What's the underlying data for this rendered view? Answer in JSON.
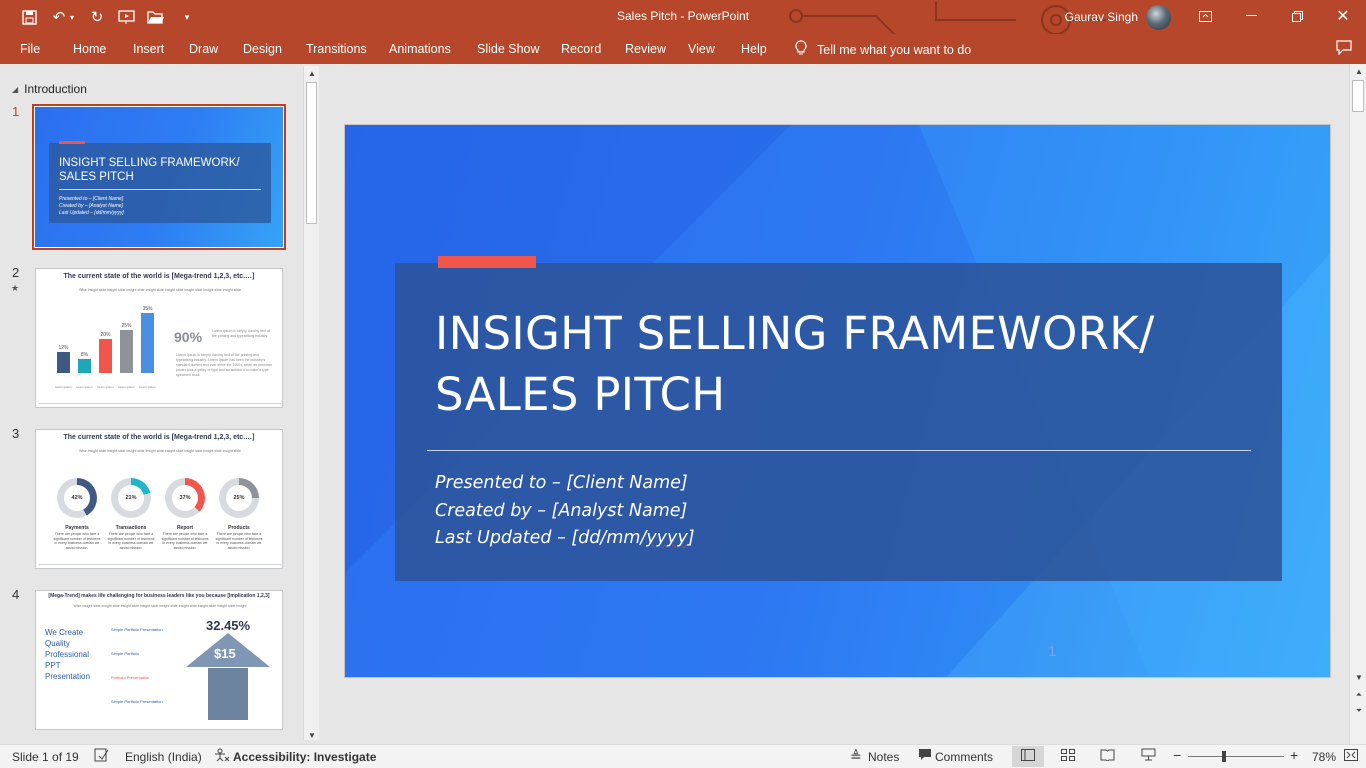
{
  "app": {
    "doc_title": "Sales Pitch  -  PowerPoint",
    "user_name": "Gaurav Singh"
  },
  "quick_access": {
    "save_icon": "save-icon",
    "undo_icon": "undo-icon",
    "redo_icon": "redo-icon",
    "present_icon": "present-from-beginning-icon",
    "open_icon": "open-folder-icon"
  },
  "ribbon": {
    "tabs": [
      "File",
      "Home",
      "Insert",
      "Draw",
      "Design",
      "Transitions",
      "Animations",
      "Slide Show",
      "Record",
      "Review",
      "View",
      "Help"
    ],
    "tell_me": "Tell me what you want to do"
  },
  "thumbnails": {
    "section": "Introduction",
    "numbers": [
      "1",
      "2",
      "3",
      "4"
    ],
    "slide1": {
      "title": "INSIGHT SELLING FRAMEWORK/ SALES PITCH",
      "lines": [
        "Presented to – [Client Name]",
        "Created by – [Analyst Name]",
        "Last Updated – [dd/mm/yyyy]"
      ]
    },
    "slide2": {
      "title": "The current state of the world is [Mega-trend 1,2,3, etc.…]",
      "bars": [
        {
          "label": "12%",
          "value": 12
        },
        {
          "label": "8%",
          "value": 8
        },
        {
          "label": "20%",
          "value": 20
        },
        {
          "label": "25%",
          "value": 25
        },
        {
          "label": "35%",
          "value": 35
        }
      ],
      "big_pct": "90%"
    },
    "slide3": {
      "title": "The current state of the world is [Mega-trend 1,2,3, etc.…]",
      "donuts": [
        {
          "pct": "42%",
          "value": 42,
          "label": "Payments",
          "color": "#3f5a82"
        },
        {
          "pct": "21%",
          "value": 21,
          "label": "Transactions",
          "color": "#1fb6c9"
        },
        {
          "pct": "37%",
          "value": 37,
          "label": "Report",
          "color": "#f0574a"
        },
        {
          "pct": "25%",
          "value": 25,
          "label": "Products",
          "color": "#8e9399"
        }
      ]
    },
    "slide4": {
      "title": "[Mega-Trend] makes life challenging for business leaders like you because [Implication 1,2,3]",
      "left_text": [
        "We Create",
        "Quality",
        "Professional",
        "PPT",
        "Presentation"
      ],
      "items": [
        "Simple Portfolio Presentation",
        "Simple Portfolio",
        "Portfolio Presentation",
        "Simple Portfolio Presentation"
      ],
      "big_pct": "32.45%",
      "amount": "$15"
    }
  },
  "slide": {
    "title_line1": "INSIGHT SELLING FRAMEWORK/",
    "title_line2": "SALES PITCH",
    "presented": "Presented to – [Client Name]",
    "created": "Created by – [Analyst Name]",
    "updated_prefix": "Last Updated – [dd/mm/",
    "updated_year": "yyyy",
    "updated_suffix": "]",
    "page_number": "1"
  },
  "status": {
    "slide_of": "Slide 1 of 19",
    "language": "English (India)",
    "accessibility": "Accessibility: Investigate",
    "notes": "Notes",
    "comments": "Comments",
    "zoom": "78%"
  },
  "colors": {
    "brand": "#b7472a",
    "slide_accent": "#f0574a",
    "slide_blue": "#2a6ef0"
  }
}
